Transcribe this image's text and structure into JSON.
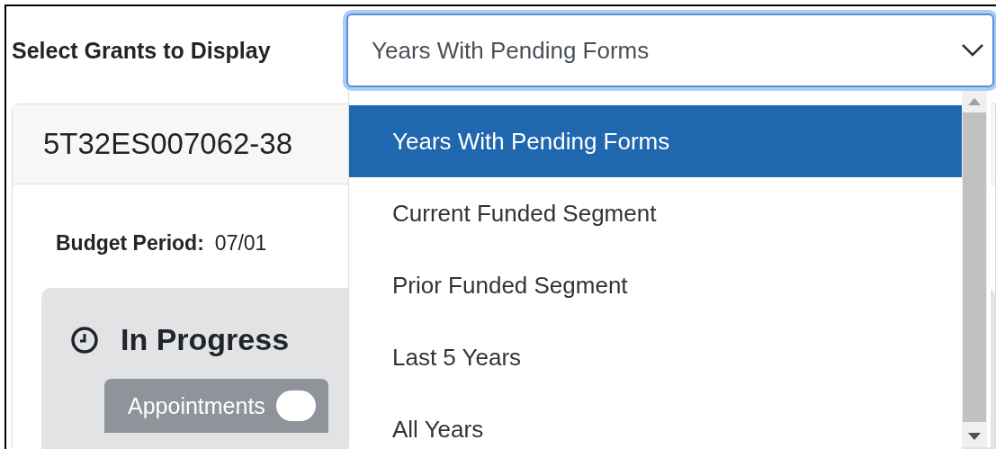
{
  "filter": {
    "label": "Select Grants to Display",
    "value": "Years With Pending Forms",
    "expanded": true,
    "options": [
      {
        "label": "Years With Pending Forms",
        "selected": true
      },
      {
        "label": "Current Funded Segment",
        "selected": false
      },
      {
        "label": "Prior Funded Segment",
        "selected": false
      },
      {
        "label": "Last 5 Years",
        "selected": false
      },
      {
        "label": "All Years",
        "selected": false
      }
    ]
  },
  "grant": {
    "number": "5T32ES007062-38",
    "budget_label": "Budget Period:",
    "budget_value": "07/01",
    "status": {
      "title": "In Progress",
      "tabs": [
        {
          "label": "Appointments",
          "selected": true
        }
      ]
    }
  }
}
